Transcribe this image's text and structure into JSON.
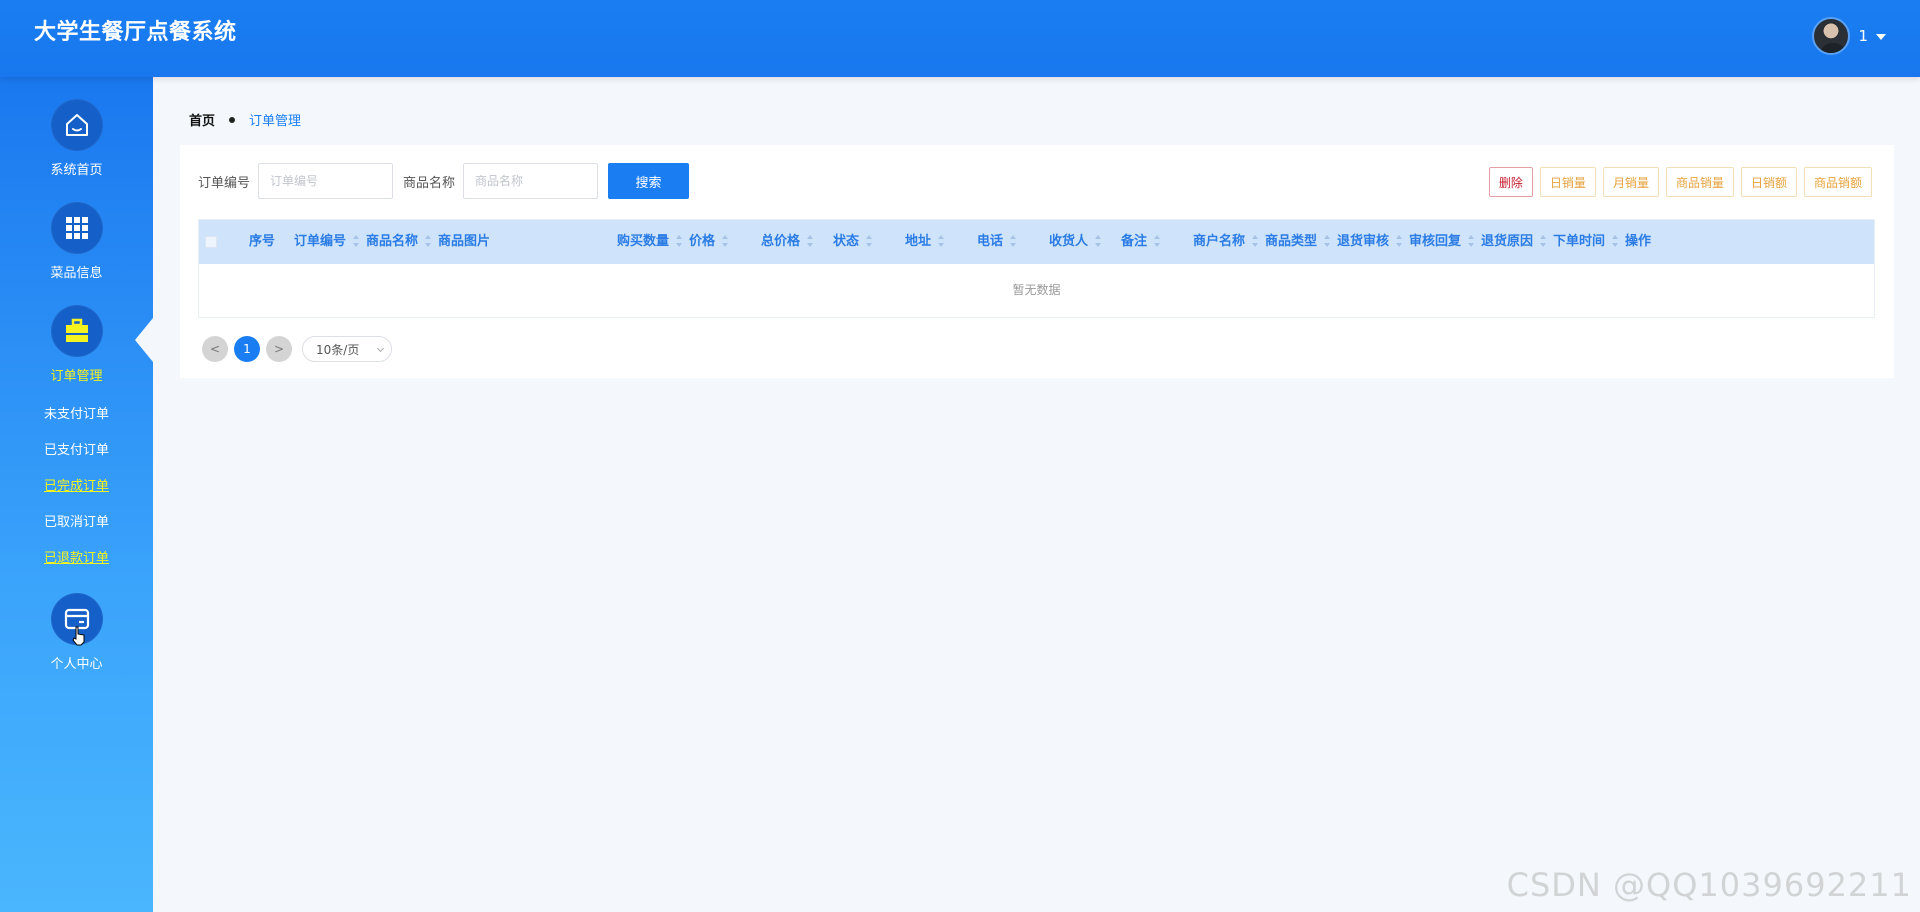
{
  "header": {
    "app_title": "大学生餐厅点餐系统",
    "user_name": "1"
  },
  "sidebar": {
    "menus": [
      {
        "label": "系统首页",
        "icon": "home-icon"
      },
      {
        "label": "菜品信息",
        "icon": "grid-icon"
      },
      {
        "label": "订单管理",
        "icon": "briefcase-icon",
        "active": true
      },
      {
        "label": "个人中心",
        "icon": "card-icon"
      }
    ],
    "submenu": [
      {
        "label": "未支付订单"
      },
      {
        "label": "已支付订单"
      },
      {
        "label": "已完成订单"
      },
      {
        "label": "已取消订单"
      },
      {
        "label": "已退款订单"
      }
    ]
  },
  "breadcrumb": {
    "home": "首页",
    "current": "订单管理"
  },
  "search": {
    "order_no_label": "订单编号",
    "order_no_placeholder": "订单编号",
    "goods_name_label": "商品名称",
    "goods_name_placeholder": "商品名称",
    "search_button": "搜索"
  },
  "actions": {
    "delete": "删除",
    "daily_sales": "日销量",
    "monthly_sales": "月销量",
    "goods_sales": "商品销量",
    "daily_amount": "日销额",
    "goods_amount": "商品销额"
  },
  "table": {
    "columns": [
      "序号",
      "订单编号",
      "商品名称",
      "商品图片",
      "购买数量",
      "价格",
      "总价格",
      "状态",
      "地址",
      "电话",
      "收货人",
      "备注",
      "商户名称",
      "商品类型",
      "退货审核",
      "审核回复",
      "退货原因",
      "下单时间",
      "操作"
    ],
    "empty_text": "暂无数据"
  },
  "pagination": {
    "prev": "<",
    "current_page": "1",
    "next": ">",
    "page_size": "10条/页"
  },
  "watermark": "CSDN @QQ1039692211",
  "colors": {
    "primary": "#1a7ef2",
    "active_menu": "#f6f31e",
    "warning": "#e6a23c",
    "danger": "#c8202f"
  }
}
